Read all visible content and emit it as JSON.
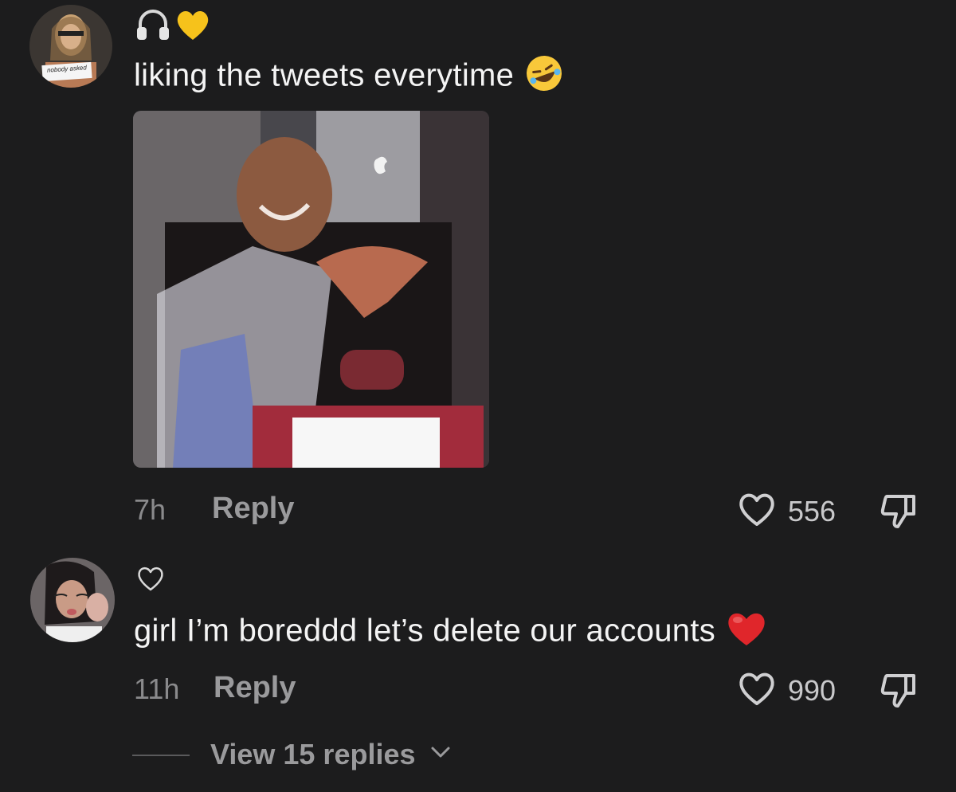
{
  "comments": [
    {
      "avatar_sign_text": "nobody asked",
      "badge_icons": [
        "headphones-icon",
        "yellow-heart-icon"
      ],
      "text": "liking the tweets everytime",
      "text_emoji": "rolling-on-floor-laughing-emoji",
      "has_media": true,
      "time": "7h",
      "reply_label": "Reply",
      "like_count": "556"
    },
    {
      "badge_icons": [
        "heart-outline-icon"
      ],
      "text": "girl I’m boreddd let’s delete our accounts",
      "text_emoji": "red-heart-emoji",
      "has_media": false,
      "time": "11h",
      "reply_label": "Reply",
      "like_count": "990",
      "view_replies_label": "View 15 replies"
    }
  ],
  "colors": {
    "background": "#1c1c1d",
    "text_primary": "#f4f4f4",
    "text_secondary": "#9a9a9c",
    "yellow_heart": "#f6c21b",
    "red_heart": "#e0262b"
  }
}
